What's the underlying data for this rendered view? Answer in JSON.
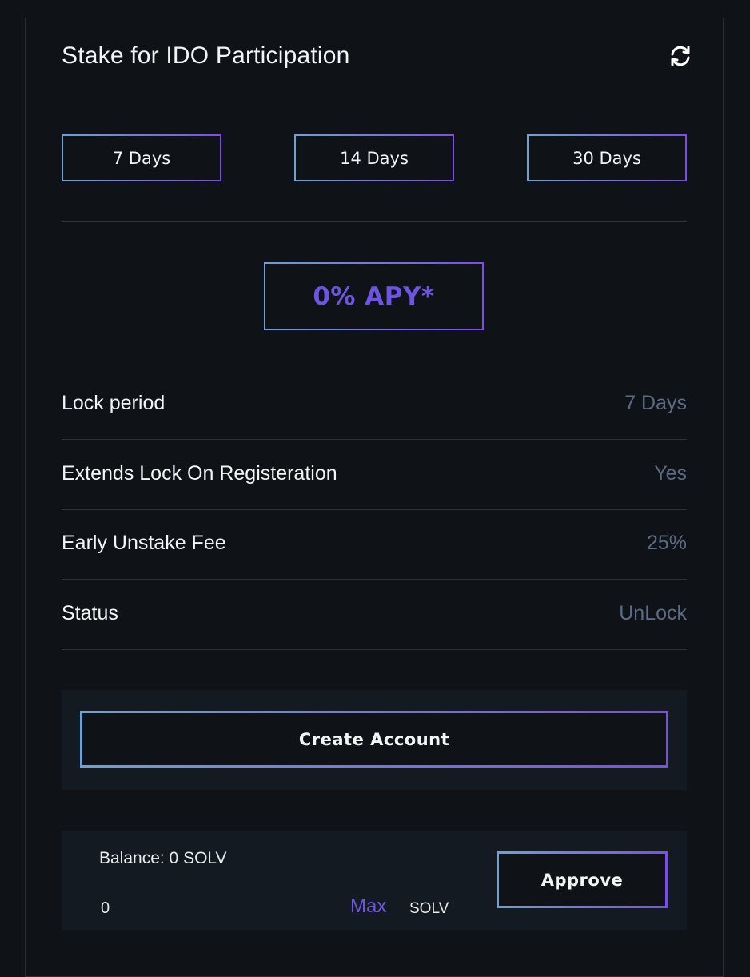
{
  "header": {
    "title": "Stake for IDO Participation",
    "refresh_icon": "refresh-icon"
  },
  "durations": [
    {
      "label": "7 Days"
    },
    {
      "label": "14 Days"
    },
    {
      "label": "30 Days"
    }
  ],
  "apy": {
    "label": "0% APY*"
  },
  "details": [
    {
      "label": "Lock period",
      "value": "7 Days"
    },
    {
      "label": "Extends Lock On Registeration",
      "value": "Yes"
    },
    {
      "label": "Early Unstake Fee",
      "value": "25%"
    },
    {
      "label": "Status",
      "value": "UnLock"
    }
  ],
  "account": {
    "create_label": "Create Account"
  },
  "stake": {
    "balance_text": "Balance: 0 SOLV",
    "amount_value": "0",
    "max_label": "Max",
    "token_label": "SOLV",
    "approve_label": "Approve"
  },
  "colors": {
    "background": "#0f1216",
    "panel": "#141a21",
    "accent_purple": "#6d55e0",
    "gradient_start": "#6fa0d6",
    "gradient_end": "#7c4ee8",
    "muted_value": "#5c6b82"
  }
}
